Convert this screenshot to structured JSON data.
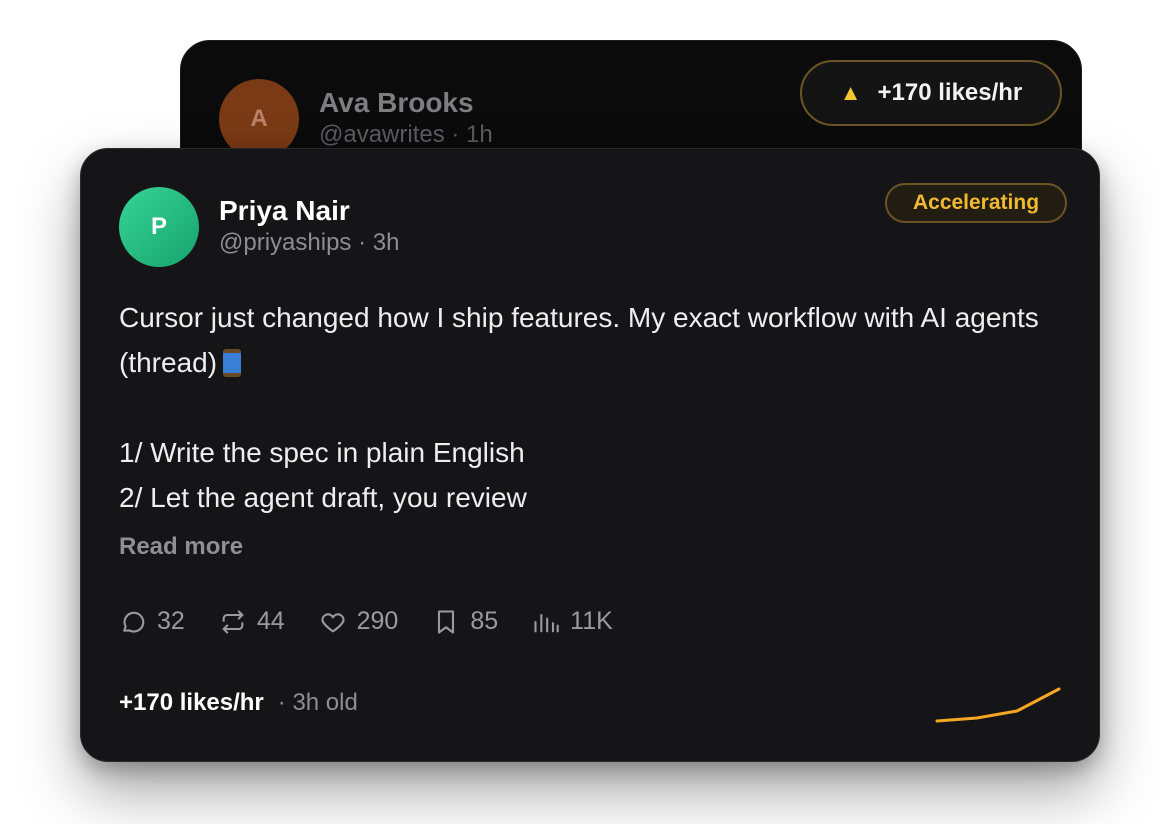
{
  "back_card": {
    "avatar_letter": "A",
    "name": "Ava Brooks",
    "meta": "@avawrites · 1h",
    "pill_label": "+170 likes/hr"
  },
  "post": {
    "avatar_letter": "P",
    "name": "Priya Nair",
    "meta": "@priyaships · 3h",
    "badge": "Accelerating",
    "line1": "Cursor just changed how I ship features. My exact workflow with AI agents (thread)",
    "step1": "1/ Write the spec in plain English",
    "step2": "2/ Let the agent draft, you review",
    "read_more": "Read more",
    "stats": {
      "replies": "32",
      "reposts": "44",
      "likes": "290",
      "bookmarks": "85",
      "views": "11K"
    },
    "velocity": "+170 likes/hr",
    "age": "· 3h old"
  },
  "colors": {
    "accent": "#f5a623",
    "badge_text": "#f1b931",
    "avatar_green": "#22c07f",
    "back_avatar": "#7a3a16"
  }
}
